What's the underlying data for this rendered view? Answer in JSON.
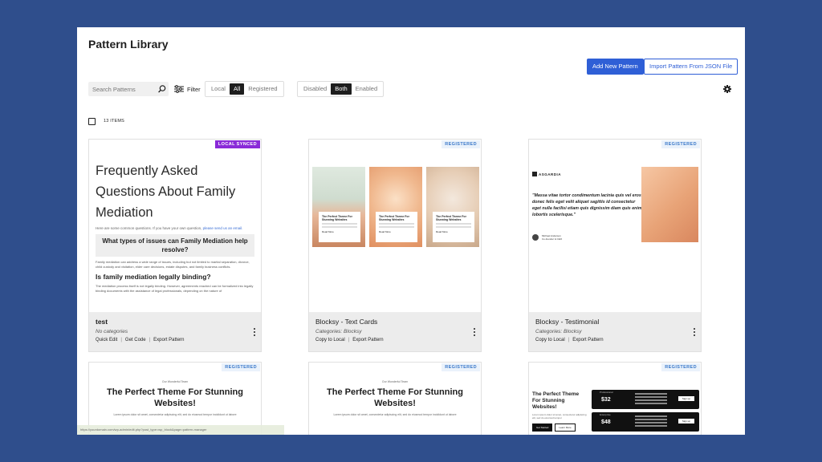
{
  "page": {
    "title": "Pattern Library"
  },
  "toolbar": {
    "add_new": "Add New Pattern",
    "import_json": "Import Pattern From JSON File",
    "search_placeholder": "Search Patterns",
    "filter_label": "Filter",
    "scope_options": [
      "Local",
      "All",
      "Registered"
    ],
    "scope_selected": "All",
    "status_options": [
      "Disabled",
      "Both",
      "Enabled"
    ],
    "status_selected": "Both"
  },
  "list": {
    "items_count": "13 ITEMS"
  },
  "cards": [
    {
      "badge": "LOCAL SYNCED",
      "title": "test",
      "categories": "No categories",
      "actions": [
        "Quick Edit",
        "Get Code",
        "Export Pattern"
      ],
      "preview": {
        "heading": "Frequently Asked Questions About Family Mediation",
        "intro": "Here are some common questions. If you have your own question,",
        "intro_link": "please send us an email.",
        "q1": "What types of issues can Family Mediation help resolve?",
        "p1": "Family mediation can address a wide range of issues, including but not limited to marital separation, divorce, child custody and visitation, elder care decisions, estate disputes, and family business conflicts.",
        "q2": "Is family mediation legally binding?",
        "p2": "The mediation process itself is not legally binding. However, agreements reached can be formalized into legally binding documents with the assistance of legal professionals, depending on the nature of"
      }
    },
    {
      "badge": "REGISTERED",
      "title": "Blocksy - Text Cards",
      "categories": "Categories: Blocksy",
      "actions": [
        "Copy to Local",
        "Export Pattern"
      ],
      "preview": {
        "card_title": "The Perfect Theme For Stunning Websites",
        "card_link": "Read More"
      }
    },
    {
      "badge": "REGISTERED",
      "title": "Blocksy - Testimonial",
      "categories": "Categories: Blocksy",
      "actions": [
        "Copy to Local",
        "Export Pattern"
      ],
      "preview": {
        "logo": "ASGARDIA",
        "quote": "\"Massa vitae tortor condimentum lacinia quis vel eros donec felis eget velit aliquet sagittis id consectetur eget nulla facilisi etiam quis dignissim diam quis enim lobortis scelerisque.\"",
        "author": "Michael Anderson",
        "role": "Co-founder & CEO"
      }
    },
    {
      "badge": "REGISTERED",
      "preview": {
        "kicker": "Our Wonderful Team",
        "heading": "The Perfect Theme For Stunning Websites!",
        "sub": "Lorem ipsum dolor sit amet, consectetur adipiscing elit, sed do eiusmod tempor incididunt ut labore"
      }
    },
    {
      "badge": "REGISTERED",
      "preview": {
        "kicker": "Our Wonderful Team",
        "heading": "The Perfect Theme For Stunning Websites!",
        "sub": "Lorem ipsum dolor sit amet, consectetur adipiscing elit, sed do eiusmod tempor incididunt ut labore"
      }
    },
    {
      "badge": "REGISTERED",
      "preview": {
        "heading": "The Perfect Theme For Stunning Websites!",
        "text": "Lorem ipsum dolor sit amet, consectetur adipiscing elit, sed do eiusmod tempor",
        "btn1": "Get Started",
        "btn2": "Learn More",
        "plan1_label": "Professional",
        "plan1_price": "$32",
        "plan2_label": "Enterprise",
        "plan2_price": "$48",
        "plan_cta": "Sign up"
      }
    }
  ],
  "status_bar": {
    "text": "https://yourdomain.com/wp-admin/edit.php?post_type=wp_block&page=pattern-manager"
  },
  "colors": {
    "background": "#2f4e8c",
    "accent": "#2f5fd6",
    "synced_badge": "#8a2ad8",
    "registered_badge": "#3a78c9"
  }
}
